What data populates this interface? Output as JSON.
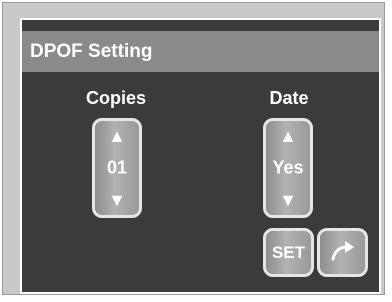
{
  "header": {
    "title": "DPOF Setting"
  },
  "copies": {
    "label": "Copies",
    "value": "01",
    "up": "▲",
    "down": "▼"
  },
  "date": {
    "label": "Date",
    "value": "Yes",
    "up": "▲",
    "down": "▼"
  },
  "actions": {
    "set_label": "SET",
    "exit_icon": "return-arrow-icon"
  },
  "colors": {
    "screen": "#3b3b3b",
    "titlebar": "#8a8a8a",
    "frame": "#c9c9c9",
    "text": "#ffffff"
  }
}
